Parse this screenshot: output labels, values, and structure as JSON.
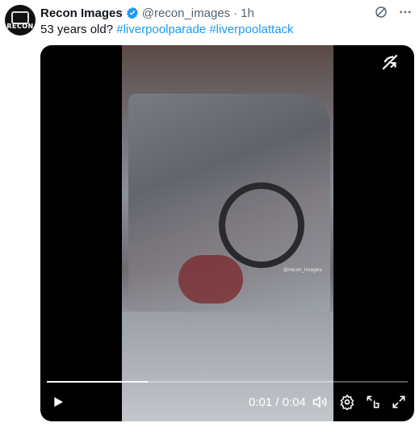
{
  "tweet": {
    "author_name": "Recon Images",
    "handle": "@recon_images",
    "separator": "·",
    "time": "1h",
    "text_plain": "53 years old? ",
    "hashtags": [
      "#liverpoolparade",
      "#liverpoolattack"
    ],
    "avatar_text": "RECON"
  },
  "video": {
    "watermark": "@recon_images",
    "progress_fraction": 0.28,
    "time_readout": "0:01 / 0:04"
  },
  "icons": {
    "verified": "verified-badge-icon",
    "grok": "grok-icon",
    "more": "more-icon",
    "exit_fullscreen": "exit-fullscreen-icon",
    "play": "play-icon",
    "volume": "volume-icon",
    "settings": "settings-icon",
    "dock": "dock-icon",
    "fullscreen": "fullscreen-icon"
  },
  "colors": {
    "hashtag": "#1d9bf0",
    "muted": "#536471",
    "verified": "#1d9bf0"
  }
}
